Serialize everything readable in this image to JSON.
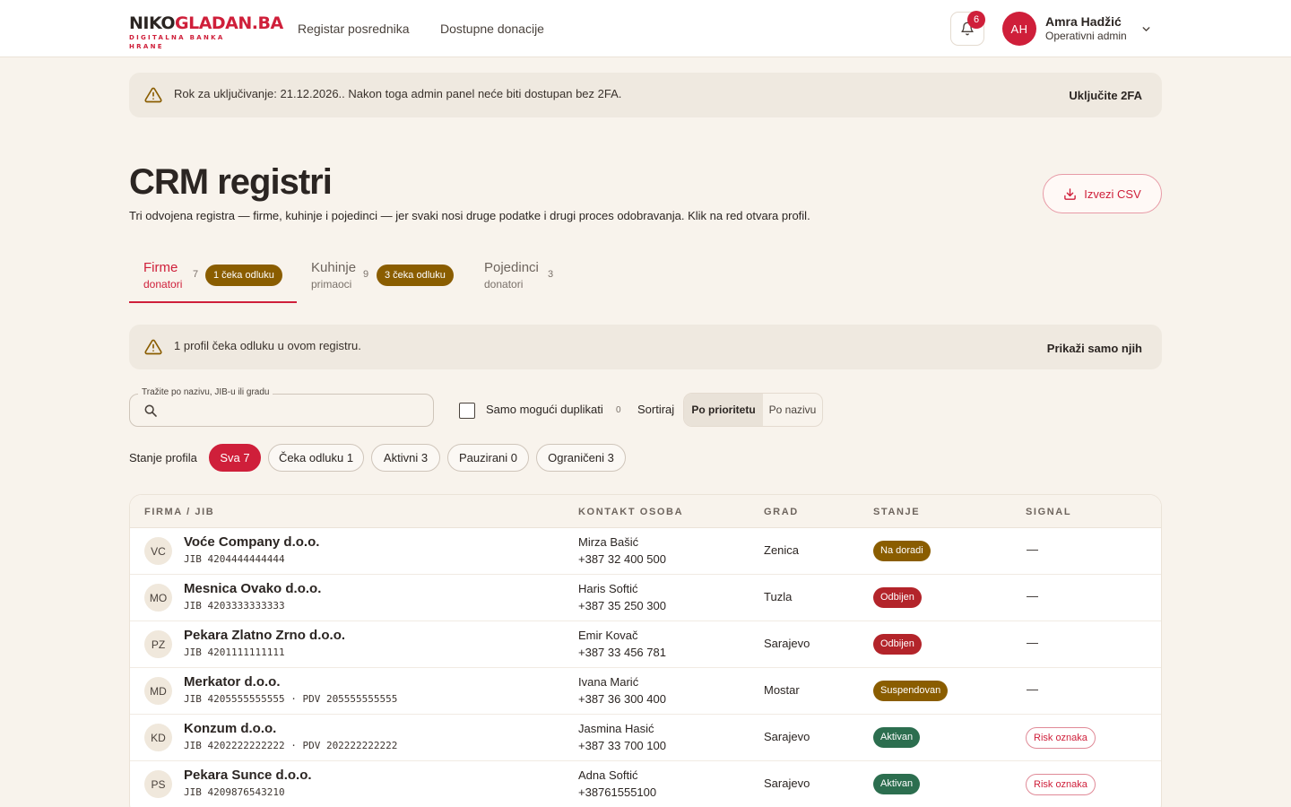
{
  "header": {
    "logo_main_dark": "NIKO",
    "logo_main_red": "GLADAN.BA",
    "logo_sub": "DIGITALNA BANKA HRANE",
    "nav": [
      "Registar posrednika",
      "Dostupne donacije"
    ],
    "notifications_count": "6",
    "user": {
      "initials": "AH",
      "name": "Amra Hadžić",
      "role": "Operativni admin"
    }
  },
  "banner_2fa": {
    "text": "Rok za uključivanje: 21.12.2026.. Nakon toga admin panel neće biti dostupan bez 2FA.",
    "action": "Uključite 2FA"
  },
  "page": {
    "title": "CRM registri",
    "subtitle": "Tri odvojena registra — firme, kuhinje i pojedinci — jer svaki nosi druge podatke i drugi proces odobravanja. Klik na red otvara profil.",
    "export_label": "Izvezi CSV"
  },
  "tabs": [
    {
      "title": "Firme",
      "sub": "donatori",
      "count": "7",
      "pill": "1 čeka odluku"
    },
    {
      "title": "Kuhinje",
      "sub": "primaoci",
      "count": "9",
      "pill": "3 čeka odluku"
    },
    {
      "title": "Pojedinci",
      "sub": "donatori",
      "count": "3",
      "pill": ""
    }
  ],
  "banner_pending": {
    "text": "1 profil čeka odluku u ovom registru.",
    "action": "Prikaži samo njih"
  },
  "filters": {
    "search_label": "Tražite po nazivu, JIB-u ili gradu",
    "search_value": "",
    "duplicates_label": "Samo mogući duplikati",
    "duplicates_count": "0",
    "sort_label": "Sortiraj",
    "sort_options": [
      "Po prioritetu",
      "Po nazivu"
    ],
    "state_label": "Stanje profila",
    "chips": [
      "Sva 7",
      "Čeka odluku 1",
      "Aktivni 3",
      "Pauzirani 0",
      "Ograničeni 3"
    ]
  },
  "table": {
    "columns": [
      "FIRMA / JIB",
      "KONTAKT OSOBA",
      "GRAD",
      "STANJE",
      "SIGNAL"
    ],
    "rows": [
      {
        "initials": "VC",
        "name": "Voće Company d.o.o.",
        "jib": "JIB 4204444444444",
        "contact": "Mirza Bašić",
        "phone": "+387 32 400 500",
        "city": "Zenica",
        "status": "Na doradi",
        "status_color": "#8a5d00",
        "signal": "—"
      },
      {
        "initials": "MO",
        "name": "Mesnica Ovako d.o.o.",
        "jib": "JIB 4203333333333",
        "contact": "Haris Softić",
        "phone": "+387 35 250 300",
        "city": "Tuzla",
        "status": "Odbijen",
        "status_color": "#b3242a",
        "signal": "—"
      },
      {
        "initials": "PZ",
        "name": "Pekara Zlatno Zrno d.o.o.",
        "jib": "JIB 4201111111111",
        "contact": "Emir Kovač",
        "phone": "+387 33 456 781",
        "city": "Sarajevo",
        "status": "Odbijen",
        "status_color": "#b3242a",
        "signal": "—"
      },
      {
        "initials": "MD",
        "name": "Merkator d.o.o.",
        "jib": "JIB 4205555555555 · PDV 205555555555",
        "contact": "Ivana Marić",
        "phone": "+387 36 300 400",
        "city": "Mostar",
        "status": "Suspendovan",
        "status_color": "#8a5d00",
        "signal": "—"
      },
      {
        "initials": "KD",
        "name": "Konzum d.o.o.",
        "jib": "JIB 4202222222222 · PDV 202222222222",
        "contact": "Jasmina Hasić",
        "phone": "+387 33 700 100",
        "city": "Sarajevo",
        "status": "Aktivan",
        "status_color": "#2c6e4f",
        "signal": "Risk oznaka"
      },
      {
        "initials": "PS",
        "name": "Pekara Sunce d.o.o.",
        "jib": "JIB 4209876543210",
        "contact": "Adna Softić",
        "phone": "+38761555100",
        "city": "Sarajevo",
        "status": "Aktivan",
        "status_color": "#2c6e4f",
        "signal": "Risk oznaka"
      }
    ]
  },
  "colors": {
    "brand_red": "#cf1f3a",
    "pending_gold": "#8a5d00",
    "rejected_red": "#b3242a",
    "active_green": "#2c6e4f",
    "background": "#f8f3ec"
  },
  "icons": [
    "warning-icon",
    "bell-icon",
    "chevron-down-icon",
    "download-icon",
    "search-icon"
  ]
}
